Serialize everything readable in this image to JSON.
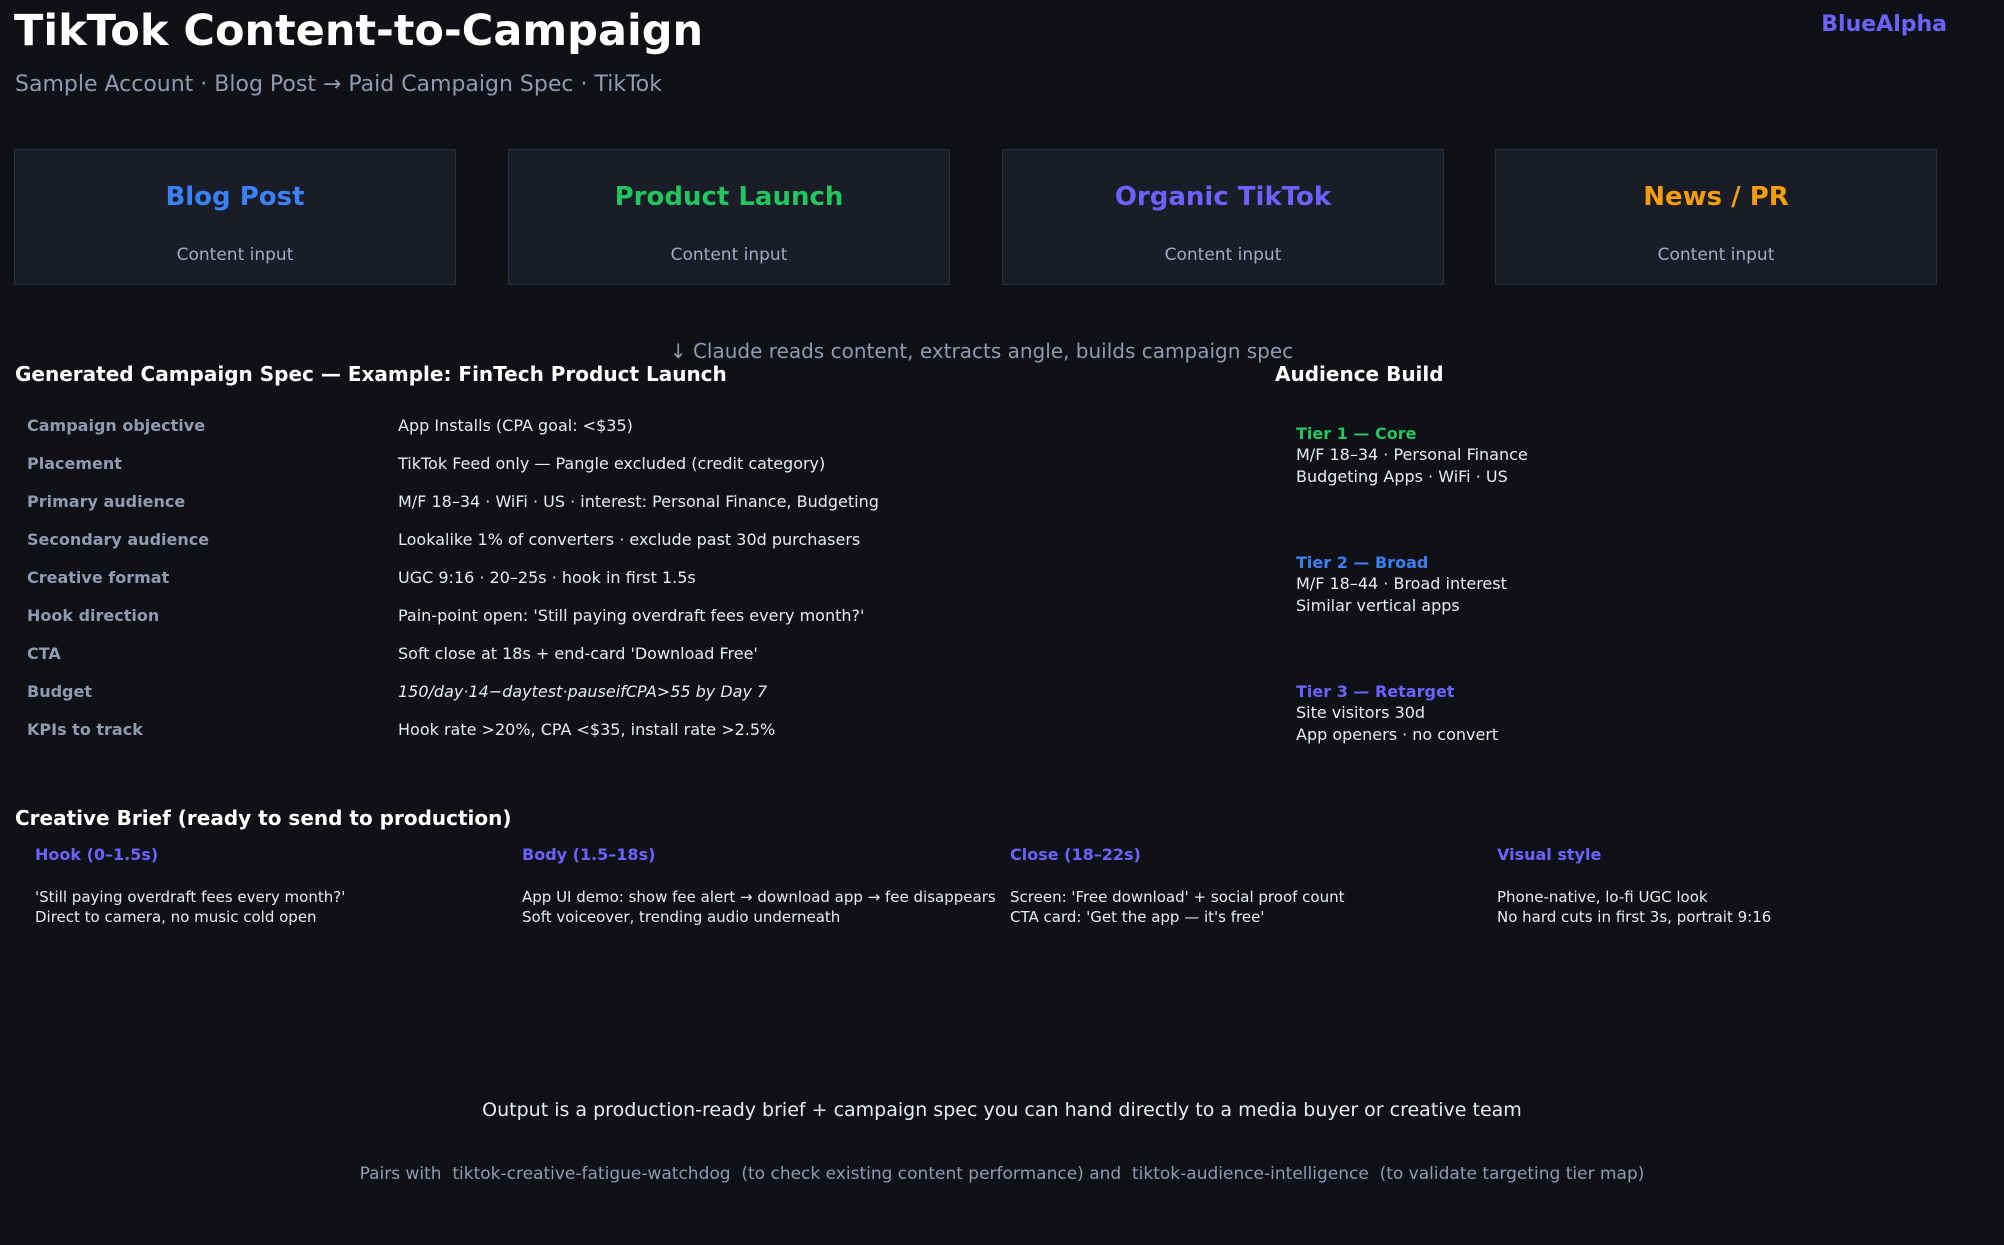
{
  "header": {
    "title": "TikTok Content-to-Campaign",
    "subtitle": "Sample Account · Blog Post → Paid Campaign Spec · TikTok",
    "brand": "BlueAlpha"
  },
  "input_cards": [
    {
      "title": "Blog Post",
      "subtitle": "Content input",
      "color": "#3b82f6"
    },
    {
      "title": "Product Launch",
      "subtitle": "Content input",
      "color": "#22c55e"
    },
    {
      "title": "Organic TikTok",
      "subtitle": "Content input",
      "color": "#6c63ff"
    },
    {
      "title": "News / PR",
      "subtitle": "Content input",
      "color": "#f59e0b"
    }
  ],
  "flow_note": "↓  Claude reads content, extracts angle, builds campaign spec",
  "campaign_spec": {
    "title": "Generated Campaign Spec — Example: FinTech Product Launch",
    "rows": [
      {
        "label": "Campaign objective",
        "value": "App Installs (CPA goal: <$35)"
      },
      {
        "label": "Placement",
        "value": "TikTok Feed only — Pangle excluded (credit category)"
      },
      {
        "label": "Primary audience",
        "value": "M/F 18–34 · WiFi · US · interest: Personal Finance, Budgeting"
      },
      {
        "label": "Secondary audience",
        "value": "Lookalike 1% of converters · exclude past 30d purchasers"
      },
      {
        "label": "Creative format",
        "value": "UGC 9:16 · 20–25s · hook in first 1.5s"
      },
      {
        "label": "Hook direction",
        "value": "Pain-point open: 'Still paying overdraft fees every month?'"
      },
      {
        "label": "CTA",
        "value": "Soft close at 18s + end-card 'Download Free'"
      },
      {
        "label": "Budget",
        "value": "150/day·14−daytest·pauseifCPA>55 by Day 7"
      },
      {
        "label": "KPIs to track",
        "value": "Hook rate >20%, CPA <$35, install rate >2.5%"
      }
    ]
  },
  "audience_build": {
    "title": "Audience Build",
    "tiers": [
      {
        "title": "Tier 1 — Core",
        "color": "#22c55e",
        "lines": [
          "M/F 18–34 · Personal Finance",
          "Budgeting Apps · WiFi · US"
        ]
      },
      {
        "title": "Tier 2 — Broad",
        "color": "#3b82f6",
        "lines": [
          "M/F 18–44 · Broad interest",
          "Similar vertical apps"
        ]
      },
      {
        "title": "Tier 3 — Retarget",
        "color": "#6c63ff",
        "lines": [
          "Site visitors 30d",
          "App openers · no convert"
        ]
      }
    ]
  },
  "creative_brief": {
    "title": "Creative Brief (ready to send to production)",
    "columns": [
      {
        "title": "Hook (0–1.5s)",
        "lines": [
          "'Still paying overdraft fees every month?'",
          "Direct to camera, no music cold open"
        ]
      },
      {
        "title": "Body (1.5–18s)",
        "lines": [
          "App UI demo: show fee alert → download app → fee disappears",
          "Soft voiceover, trending audio underneath"
        ]
      },
      {
        "title": "Close (18–22s)",
        "lines": [
          "Screen: 'Free download' + social proof count",
          "CTA card: 'Get the app — it's free'"
        ]
      },
      {
        "title": "Visual style",
        "lines": [
          "Phone-native, lo-fi UGC look",
          "No hard cuts in first 3s, portrait 9:16"
        ]
      }
    ]
  },
  "footer": {
    "output_note": "Output is a production-ready brief + campaign spec you can hand directly to a media buyer or creative team",
    "pairs_note": "Pairs with  tiktok-creative-fatigue-watchdog  (to check existing content performance) and  tiktok-audience-intelligence  (to validate targeting tier map)"
  }
}
